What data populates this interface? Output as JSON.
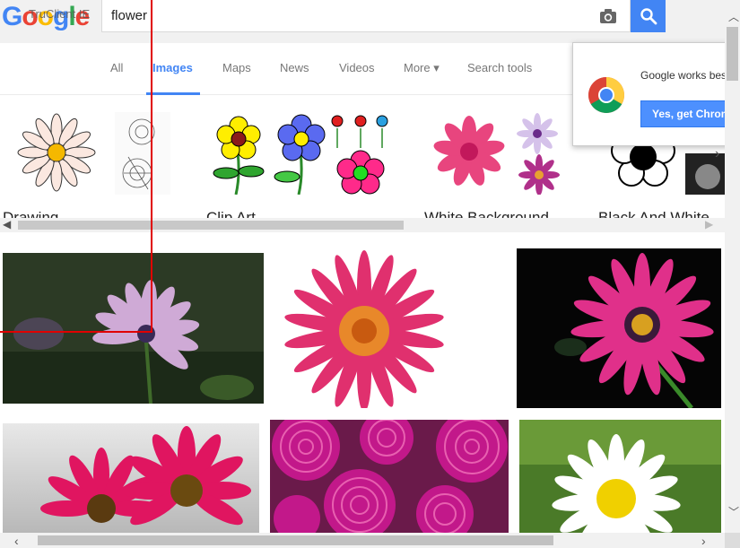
{
  "header": {
    "logo_text": "Google",
    "overlay_text": "TruClient IE",
    "search_value": "flower"
  },
  "nav": {
    "tabs": [
      {
        "label": "All"
      },
      {
        "label": "Images"
      },
      {
        "label": "Maps"
      },
      {
        "label": "News"
      },
      {
        "label": "Videos"
      },
      {
        "label": "More ▾"
      },
      {
        "label": "Search tools"
      }
    ]
  },
  "popup": {
    "text": "Google works best",
    "button": "Yes, get Chrome"
  },
  "related": [
    {
      "label": "Drawing"
    },
    {
      "label": "Clip Art"
    },
    {
      "label": "White Background"
    },
    {
      "label": "Black And White"
    }
  ],
  "colors": {
    "accent": "#4285f4",
    "crosshair": "#e00000",
    "pink": "#e0306e",
    "magenta": "#c2188a"
  }
}
